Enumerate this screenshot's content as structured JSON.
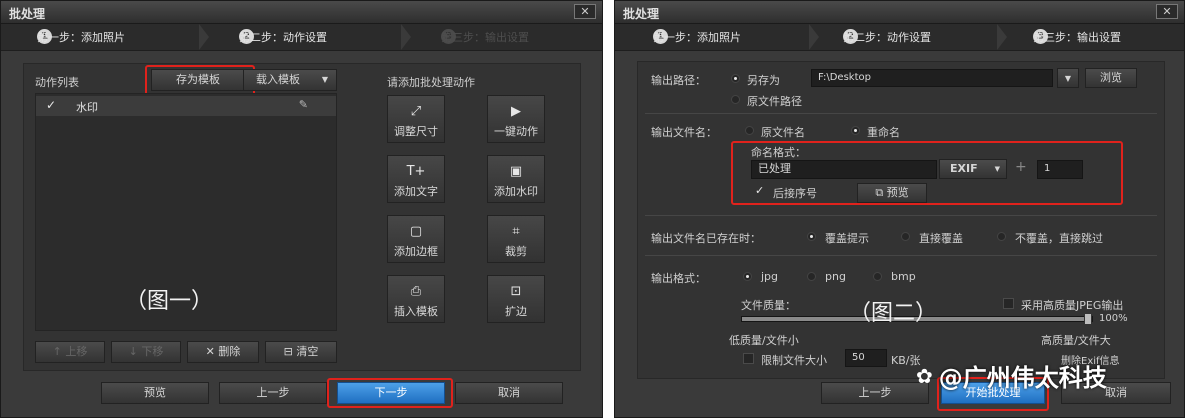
{
  "left": {
    "title": "批处理",
    "close": "✕",
    "steps": [
      {
        "num": "1",
        "label": "第一步：添加照片"
      },
      {
        "num": "2",
        "label": "第二步：动作设置"
      },
      {
        "num": "3",
        "label": "第三步：输出设置"
      }
    ],
    "action_list_label": "动作列表",
    "save_template": "存为模板",
    "load_template": "载入模板",
    "list_items": [
      {
        "label": "水印"
      }
    ],
    "add_action_prompt": "请添加批处理动作",
    "actions": [
      {
        "icon": "⤢",
        "label": "调整尺寸"
      },
      {
        "icon": "▶",
        "label": "一键动作"
      },
      {
        "icon": "T+",
        "label": "添加文字"
      },
      {
        "icon": "▣",
        "label": "添加水印"
      },
      {
        "icon": "▢",
        "label": "添加边框"
      },
      {
        "icon": "⌗",
        "label": "裁剪"
      },
      {
        "icon": "⎙",
        "label": "插入模板"
      },
      {
        "icon": "⊡",
        "label": "扩边"
      }
    ],
    "list_tools": [
      {
        "icon": "↑",
        "label": "上移"
      },
      {
        "icon": "↓",
        "label": "下移"
      },
      {
        "icon": "✕",
        "label": "删除"
      },
      {
        "icon": "⊟",
        "label": "清空"
      }
    ],
    "caption": "（图一）",
    "footer": {
      "preview": "预览",
      "prev": "上一步",
      "next": "下一步",
      "cancel": "取消"
    }
  },
  "right": {
    "title": "批处理",
    "close": "✕",
    "steps": [
      {
        "num": "1",
        "label": "第一步：添加照片"
      },
      {
        "num": "2",
        "label": "第二步：动作设置"
      },
      {
        "num": "3",
        "label": "第三步：输出设置"
      }
    ],
    "output_path_label": "输出路径：",
    "save_as": "另存为",
    "path_value": "F:\\Desktop",
    "browse": "浏览",
    "original_path": "原文件路径",
    "output_name_label": "输出文件名：",
    "original_name": "原文件名",
    "rename": "重命名",
    "naming_format": "命名格式：",
    "name_value": "已处理",
    "exif": "EXIF",
    "plus": "+",
    "seq_value": "1",
    "append_seq": "后接序号",
    "preview_btn": "预览",
    "exists_label": "输出文件名已存在时：",
    "overwrite_prompt": "覆盖提示",
    "overwrite": "直接覆盖",
    "skip": "不覆盖，直接跳过",
    "format_label": "输出格式：",
    "formats": [
      "jpg",
      "png",
      "bmp"
    ],
    "quality_label": "文件质量：",
    "hq_jpeg": "采用高质量JPEG输出",
    "quality_value": "100%",
    "quality_fraction": 1.0,
    "low_quality": "低质量/文件小",
    "high_quality": "高质量/文件大",
    "limit_size": "限制文件大小",
    "limit_value": "50",
    "limit_unit": "KB/张",
    "delete_exif": "删除Exif信息",
    "caption": "（图二）",
    "footer": {
      "prev": "上一步",
      "start": "开始批处理",
      "cancel": "取消"
    }
  },
  "watermark": "@广州伟太科技"
}
